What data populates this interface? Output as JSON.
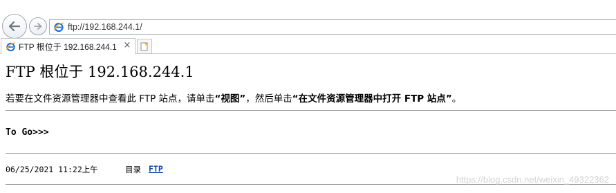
{
  "browser": {
    "address_url": "ftp://192.168.244.1/",
    "tab_title": "FTP 根位于 192.168.244.1",
    "tab_close_glyph": "×",
    "icons": {
      "back": "back-arrow-icon",
      "forward": "forward-arrow-icon",
      "address_favicon": "ie-logo-icon",
      "tab_favicon": "ie-logo-icon",
      "new_tab": "new-tab-icon"
    },
    "accent_color": "#1e6fd9"
  },
  "page": {
    "title": "FTP 根位于 192.168.244.1",
    "instruction_pre": "若要在文件资源管理器中查看此 FTP 站点，请单击",
    "instruction_view": "“视图”",
    "instruction_mid": "，然后单击",
    "instruction_open": "“在文件资源管理器中打开 FTP 站点”",
    "instruction_end": "。",
    "to_go": "To Go>>>",
    "entries": [
      {
        "date": "06/25/2021 11:22上午",
        "kind": "目录",
        "name": "FTP"
      }
    ],
    "link_color": "#0645ad"
  },
  "watermark": "https://blog.csdn.net/weixin_49322362"
}
